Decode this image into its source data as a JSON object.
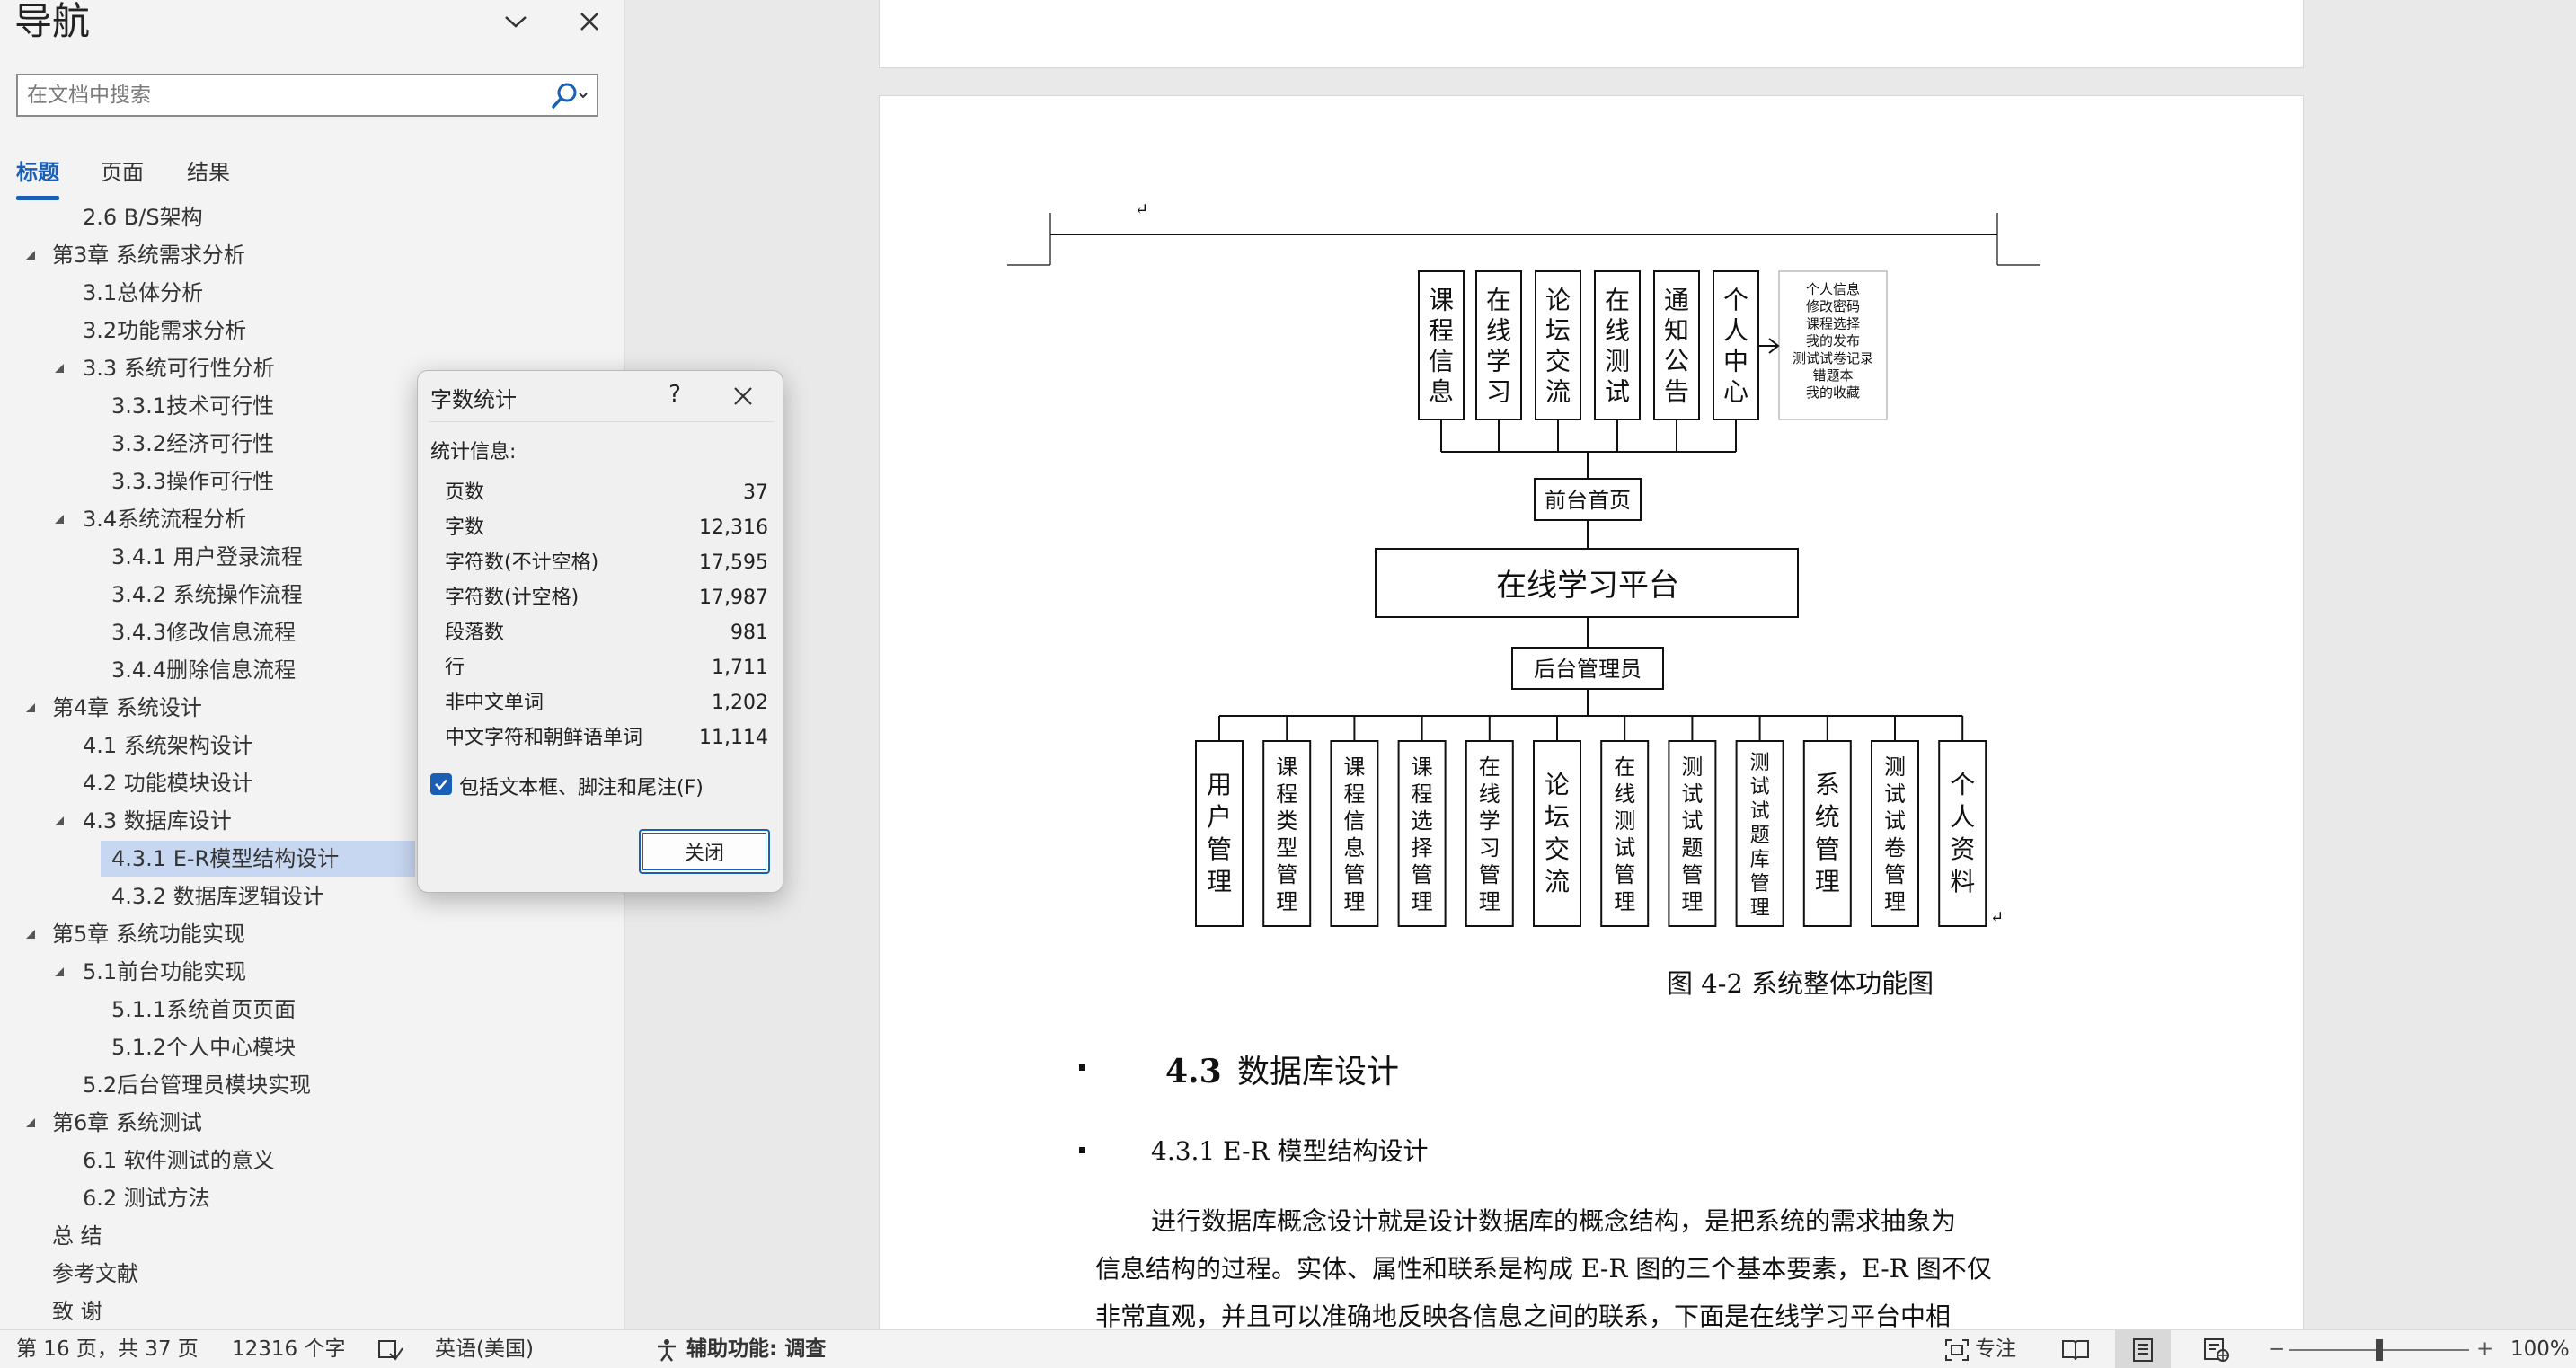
{
  "nav": {
    "title": "导航",
    "search_placeholder": "在文档中搜索",
    "tabs": [
      "标题",
      "页面",
      "结果"
    ],
    "tree": [
      {
        "label": "2.6 B/S架构",
        "level": 2,
        "expand": ""
      },
      {
        "label": "第3章 系统需求分析",
        "level": 1,
        "expand": "open"
      },
      {
        "label": "3.1总体分析",
        "level": 2,
        "expand": ""
      },
      {
        "label": "3.2功能需求分析",
        "level": 2,
        "expand": ""
      },
      {
        "label": "3.3 系统可行性分析",
        "level": 2,
        "expand": "open"
      },
      {
        "label": "3.3.1技术可行性",
        "level": 3,
        "expand": ""
      },
      {
        "label": "3.3.2经济可行性",
        "level": 3,
        "expand": ""
      },
      {
        "label": "3.3.3操作可行性",
        "level": 3,
        "expand": ""
      },
      {
        "label": "3.4系统流程分析",
        "level": 2,
        "expand": "open"
      },
      {
        "label": "3.4.1 用户登录流程",
        "level": 3,
        "expand": ""
      },
      {
        "label": "3.4.2 系统操作流程",
        "level": 3,
        "expand": ""
      },
      {
        "label": "3.4.3修改信息流程",
        "level": 3,
        "expand": ""
      },
      {
        "label": "3.4.4删除信息流程",
        "level": 3,
        "expand": ""
      },
      {
        "label": "第4章 系统设计",
        "level": 1,
        "expand": "open"
      },
      {
        "label": "4.1 系统架构设计",
        "level": 2,
        "expand": ""
      },
      {
        "label": "4.2 功能模块设计",
        "level": 2,
        "expand": ""
      },
      {
        "label": "4.3 数据库设计",
        "level": 2,
        "expand": "open"
      },
      {
        "label": "4.3.1 E-R模型结构设计",
        "level": 3,
        "expand": "",
        "selected": true
      },
      {
        "label": "4.3.2 数据库逻辑设计",
        "level": 3,
        "expand": ""
      },
      {
        "label": "第5章 系统功能实现",
        "level": 1,
        "expand": "open"
      },
      {
        "label": "5.1前台功能实现",
        "level": 2,
        "expand": "open"
      },
      {
        "label": "5.1.1系统首页页面",
        "level": 3,
        "expand": ""
      },
      {
        "label": "5.1.2个人中心模块",
        "level": 3,
        "expand": ""
      },
      {
        "label": "5.2后台管理员模块实现",
        "level": 2,
        "expand": ""
      },
      {
        "label": "第6章 系统测试",
        "level": 1,
        "expand": "open"
      },
      {
        "label": "6.1 软件测试的意义",
        "level": 2,
        "expand": ""
      },
      {
        "label": "6.2 测试方法",
        "level": 2,
        "expand": ""
      },
      {
        "label": "总 结",
        "level": 1,
        "expand": ""
      },
      {
        "label": "参考文献",
        "level": 1,
        "expand": ""
      },
      {
        "label": "致 谢",
        "level": 1,
        "expand": ""
      }
    ]
  },
  "dialog": {
    "title": "字数统计",
    "help": "?",
    "section": "统计信息:",
    "stats": [
      {
        "label": "页数",
        "value": "37"
      },
      {
        "label": "字数",
        "value": "12,316"
      },
      {
        "label": "字符数(不计空格)",
        "value": "17,595"
      },
      {
        "label": "字符数(计空格)",
        "value": "17,987"
      },
      {
        "label": "段落数",
        "value": "981"
      },
      {
        "label": "行",
        "value": "1,711"
      },
      {
        "label": "非中文单词",
        "value": "1,202"
      },
      {
        "label": "中文字符和朝鲜语单词",
        "value": "11,114"
      }
    ],
    "checkbox_label": "包括文本框、脚注和尾注(F)",
    "checkbox_checked": true,
    "close_label": "关闭"
  },
  "document": {
    "diagram": {
      "top_modules": [
        "课程信息",
        "在线学习",
        "论坛交流",
        "在线测试",
        "通知公告",
        "个人中心"
      ],
      "personal_list": [
        "个人信息",
        "修改密码",
        "课程选择",
        "我的发布",
        "测试试卷记录",
        "错题本",
        "我的收藏"
      ],
      "front_home": "前台首页",
      "platform": "在线学习平台",
      "admin": "后台管理员",
      "bottom_modules": [
        "用户管理",
        "课程类型管理",
        "课程信息管理",
        "课程选择管理",
        "在线学习管理",
        "论坛交流",
        "在线测试管理",
        "测试试题管理",
        "测试试题库管理",
        "系统管理",
        "测试试卷管理",
        "个人资料"
      ]
    },
    "caption": "图 4-2  系统整体功能图",
    "heading_num": "4.3",
    "heading_text": "数据库设计",
    "subheading": "4.3.1 E-R 模型结构设计",
    "paragraph_lines": [
      "进行数据库概念设计就是设计数据库的概念结构，是把系统的需求抽象为",
      "信息结构的过程。实体、属性和联系是构成 E-R 图的三个基本要素，E-R 图不仅",
      "非常直观，并且可以准确地反映各信息之间的联系，下面是在线学习平台中相"
    ]
  },
  "status": {
    "page": "第 16 页，共 37 页",
    "words": "12316 个字",
    "language": "英语(美国)",
    "accessibility": "辅助功能: 调查",
    "focus": "专注",
    "zoom": "100%",
    "zoom_level": 1.0
  }
}
